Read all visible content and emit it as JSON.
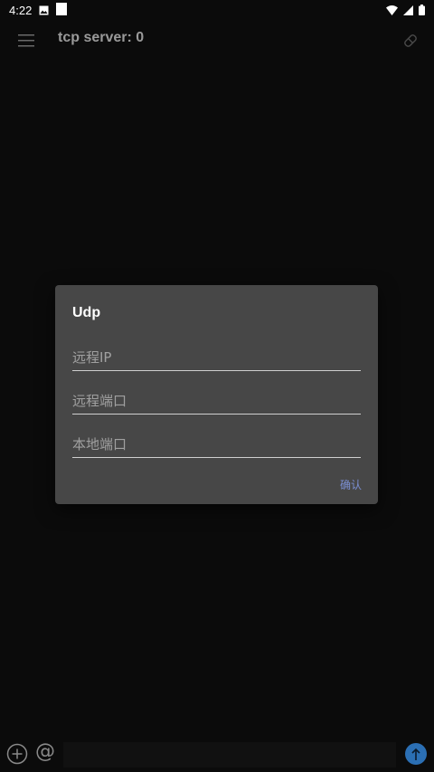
{
  "status_bar": {
    "time": "4:22",
    "icons": [
      "image-icon",
      "square-notification-icon",
      "wifi-icon",
      "signal-icon",
      "battery-icon"
    ]
  },
  "app_bar": {
    "title": "tcp server: 0",
    "left_icon": "menu-icon",
    "right_icon": "eraser-icon"
  },
  "dialog": {
    "title": "Udp",
    "fields": {
      "remote_ip": {
        "placeholder": "远程IP",
        "value": ""
      },
      "remote_port": {
        "placeholder": "远程端口",
        "value": ""
      },
      "local_port": {
        "placeholder": "本地端口",
        "value": ""
      }
    },
    "confirm_label": "确认"
  },
  "bottom_bar": {
    "add_icon": "plus-circle-icon",
    "at_label": "@",
    "send_icon": "send-icon"
  },
  "colors": {
    "background": "#0b0b0b",
    "dialog": "#474747",
    "accent": "#7b8fd3",
    "send": "#2b6fb4"
  }
}
